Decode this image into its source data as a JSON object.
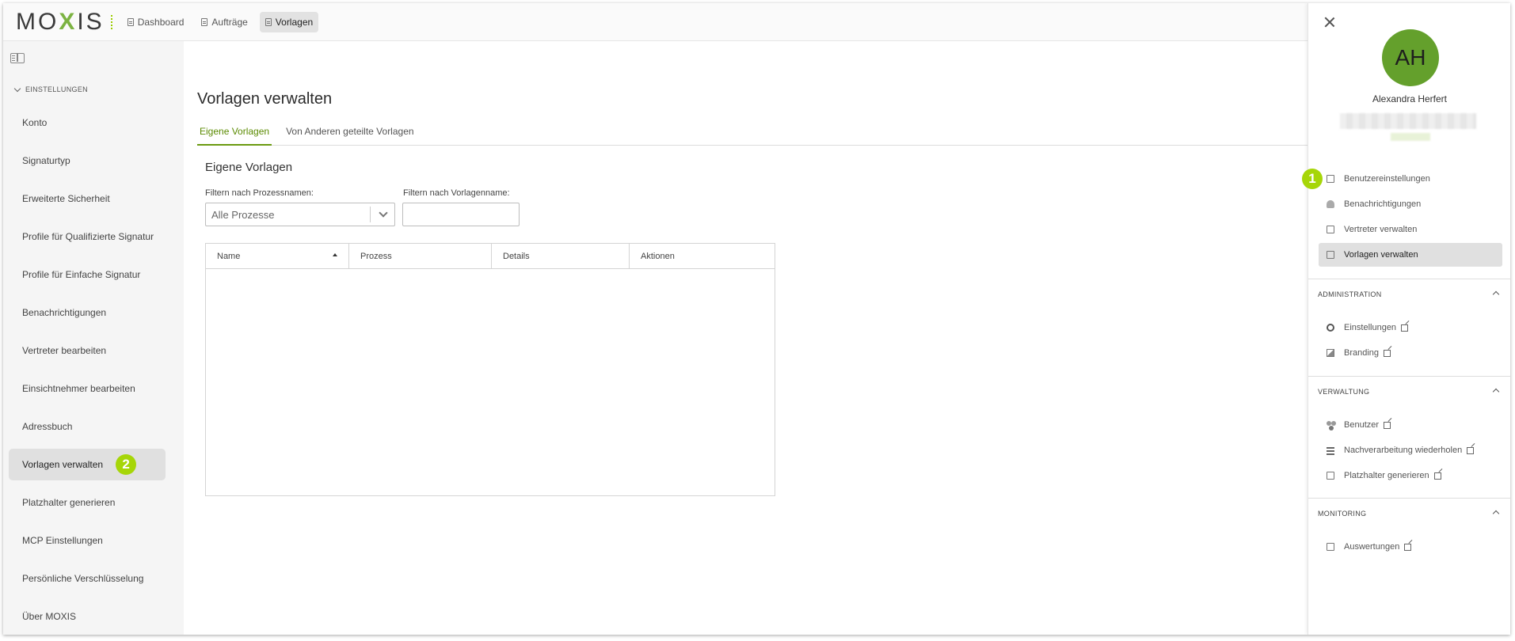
{
  "brand": {
    "logo_text_pre": "MO",
    "logo_x": "X",
    "logo_text_post": "IS",
    "accent": "#a6d608"
  },
  "topnav": {
    "dashboard": "Dashboard",
    "orders": "Aufträge",
    "templates": "Vorlagen"
  },
  "sidebar": {
    "section": "EINSTELLUNGEN",
    "items": [
      "Konto",
      "Signaturtyp",
      "Erweiterte Sicherheit",
      "Profile für Qualifizierte Signatur",
      "Profile für Einfache Signatur",
      "Benachrichtigungen",
      "Vertreter bearbeiten",
      "Einsichtnehmer bearbeiten",
      "Adressbuch",
      "Vorlagen verwalten",
      "Platzhalter generieren",
      "MCP Einstellungen",
      "Persönliche Verschlüsselung",
      "Über MOXIS"
    ],
    "active_badge": "2"
  },
  "main": {
    "title": "Vorlagen verwalten",
    "tabs": [
      "Eigene Vorlagen",
      "Von Anderen geteilte Vorlagen"
    ],
    "subtitle": "Eigene Vorlagen",
    "filter_process_label": "Filtern nach Prozessnamen:",
    "filter_process_value": "Alle Prozesse",
    "filter_name_label": "Filtern nach Vorlagenname:",
    "filter_name_value": "",
    "table": {
      "columns": [
        "Name",
        "Prozess",
        "Details",
        "Aktionen"
      ]
    }
  },
  "panel": {
    "initials": "AH",
    "avatar_color": "#64a02c",
    "user_name": "Alexandra Herfert",
    "user_items": [
      "Benutzereinstellungen",
      "Benachrichtigungen",
      "Vertreter verwalten",
      "Vorlagen verwalten"
    ],
    "first_badge": "1",
    "admin_head": "ADMINISTRATION",
    "admin_items": [
      "Einstellungen",
      "Branding"
    ],
    "verwaltung_head": "VERWALTUNG",
    "verwaltung_items": [
      "Benutzer",
      "Nachverarbeitung wiederholen",
      "Platzhalter generieren"
    ],
    "monitoring_head": "MONITORING",
    "monitoring_items": [
      "Auswertungen"
    ]
  }
}
